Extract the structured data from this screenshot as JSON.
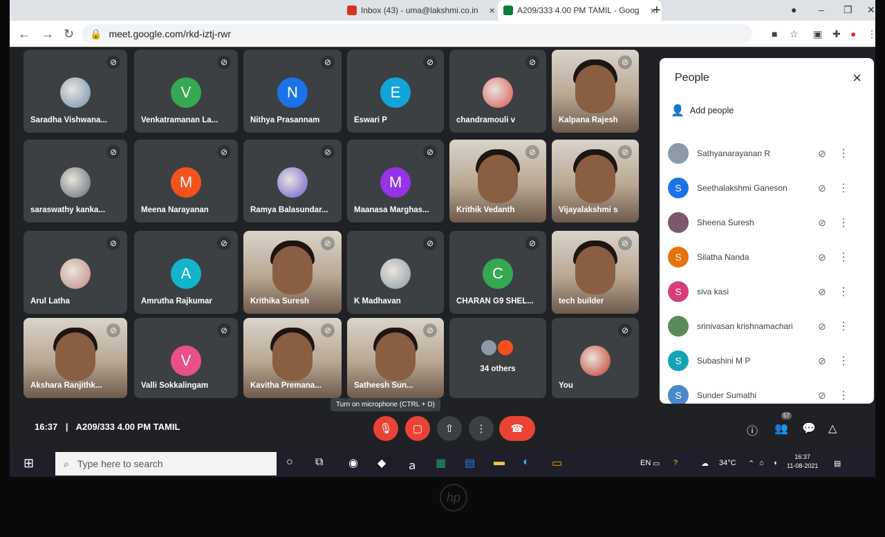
{
  "browser": {
    "tabs": [
      {
        "label": "Inbox (43) - uma@lakshmi.co.in",
        "close": "×"
      },
      {
        "label": "A209/333 4.00 PM TAMIL - Goog",
        "close": "×"
      }
    ],
    "new_tab": "+",
    "url": "meet.google.com/rkd-iztj-rwr"
  },
  "tiles": [
    {
      "name": "Saradha Vishwana...",
      "avatar": "photo",
      "color": "#6f8fb0"
    },
    {
      "name": "Venkatramanan La...",
      "avatar": "V",
      "color": "#34a853"
    },
    {
      "name": "Nithya Prasannam",
      "avatar": "N",
      "color": "#1a73e8"
    },
    {
      "name": "Eswari P",
      "avatar": "E",
      "color": "#12a4d9"
    },
    {
      "name": "chandramouli v",
      "avatar": "photo",
      "color": "#d9534f"
    },
    {
      "name": "Kalpana Rajesh",
      "avatar": "video",
      "color": "#d9d4cb"
    },
    {
      "name": "saraswathy kanka...",
      "avatar": "photo",
      "color": "#5f6a72"
    },
    {
      "name": "Meena Narayanan",
      "avatar": "M",
      "color": "#f4511e"
    },
    {
      "name": "Ramya Balasundar...",
      "avatar": "photo",
      "color": "#6a5acd"
    },
    {
      "name": "Maanasa Marghas...",
      "avatar": "M",
      "color": "#9334e6"
    },
    {
      "name": "Krithik Vedanth",
      "avatar": "video",
      "color": "#d9d4cb"
    },
    {
      "name": "Vijayalakshmi s",
      "avatar": "video",
      "color": "#d9d4cb"
    },
    {
      "name": "Arul Latha",
      "avatar": "photo",
      "color": "#c08a7a"
    },
    {
      "name": "Amrutha Rajkumar",
      "avatar": "A",
      "color": "#12b5cb"
    },
    {
      "name": "Krithika Suresh",
      "avatar": "video",
      "color": "#d9d4cb"
    },
    {
      "name": "K Madhavan",
      "avatar": "photo",
      "color": "#8a9aa8"
    },
    {
      "name": "CHARAN G9 SHEL...",
      "avatar": "C",
      "color": "#34a853"
    },
    {
      "name": "tech builder",
      "avatar": "video",
      "color": "#d9d4cb"
    },
    {
      "name": "Akshara Ranjithk...",
      "avatar": "video",
      "color": "#d9d4cb"
    },
    {
      "name": "Valli Sokkalingam",
      "avatar": "V",
      "color": "#e8508a"
    },
    {
      "name": "Kavitha Premana...",
      "avatar": "video",
      "color": "#d9d4cb"
    },
    {
      "name": "Satheesh Sun...",
      "avatar": "video",
      "color": "#d9d4cb"
    },
    {
      "name": "34 others",
      "avatar": "others",
      "color": "#3c4043"
    },
    {
      "name": "You",
      "avatar": "photo",
      "color": "#c0392b"
    }
  ],
  "people": {
    "title": "People",
    "close": "×",
    "add_people": "Add people",
    "list": [
      {
        "name": "Sathyanarayanan R",
        "initial": "",
        "color": "#8a9aa8"
      },
      {
        "name": "Seethalakshmi Ganeson",
        "initial": "S",
        "color": "#1a73e8"
      },
      {
        "name": "Sheena Suresh",
        "initial": "",
        "color": "#7a5a6a"
      },
      {
        "name": "Silatha Nanda",
        "initial": "S",
        "color": "#e8710a"
      },
      {
        "name": "siva kasi",
        "initial": "S",
        "color": "#d93c7a"
      },
      {
        "name": "srinivasan krishnamachari",
        "initial": "",
        "color": "#5a8a5a"
      },
      {
        "name": "Subashini M P",
        "initial": "S",
        "color": "#12a4b5"
      },
      {
        "name": "Sunder Sumathi",
        "initial": "S",
        "color": "#4a8ac9"
      }
    ]
  },
  "bottom": {
    "time": "16:37",
    "separator": "|",
    "meeting": "A209/333 4.00 PM TAMIL",
    "tooltip": "Turn on microphone (CTRL + D)",
    "participant_count": "57"
  },
  "taskbar": {
    "search_placeholder": "Type here to search",
    "lang": "EN",
    "temp": "34°C",
    "clock_time": "16:37",
    "clock_date": "11-08-2021"
  }
}
